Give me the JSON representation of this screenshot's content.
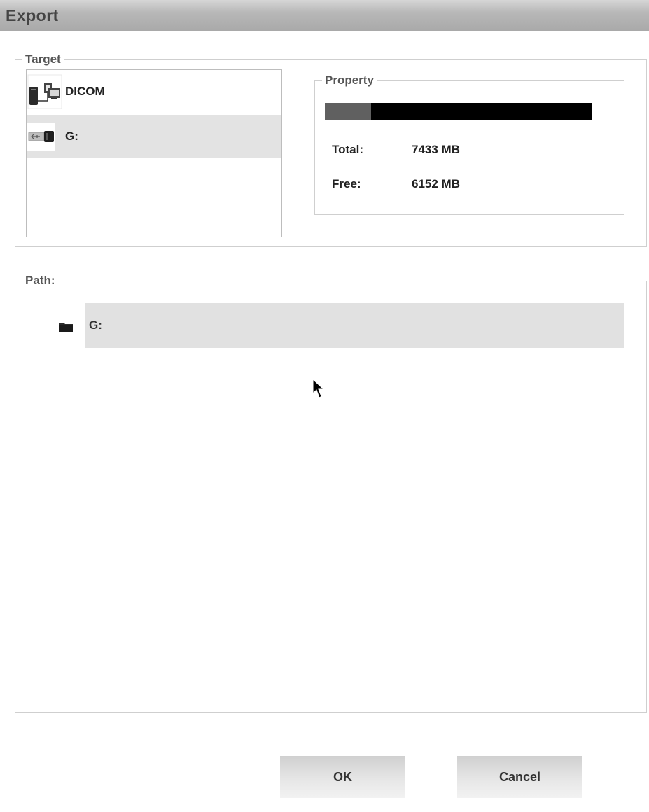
{
  "window": {
    "title": "Export"
  },
  "target": {
    "legend": "Target",
    "items": [
      {
        "label": "DICOM",
        "icon": "dicom-network-icon",
        "selected": false
      },
      {
        "label": "G:",
        "icon": "usb-drive-icon",
        "selected": true
      }
    ]
  },
  "property": {
    "legend": "Property",
    "used_fraction": 0.172,
    "total_label": "Total:",
    "total_value": "7433 MB",
    "free_label": "Free:",
    "free_value": "6152 MB"
  },
  "path": {
    "legend": "Path:",
    "items": [
      {
        "label": "G:",
        "icon": "folder-icon",
        "selected": true
      }
    ]
  },
  "buttons": {
    "ok": "OK",
    "cancel": "Cancel"
  },
  "colors": {
    "titlebar": "#b8b8b8",
    "selection": "#e3e3e3",
    "bar_used": "#606060",
    "bar_free": "#000000"
  }
}
